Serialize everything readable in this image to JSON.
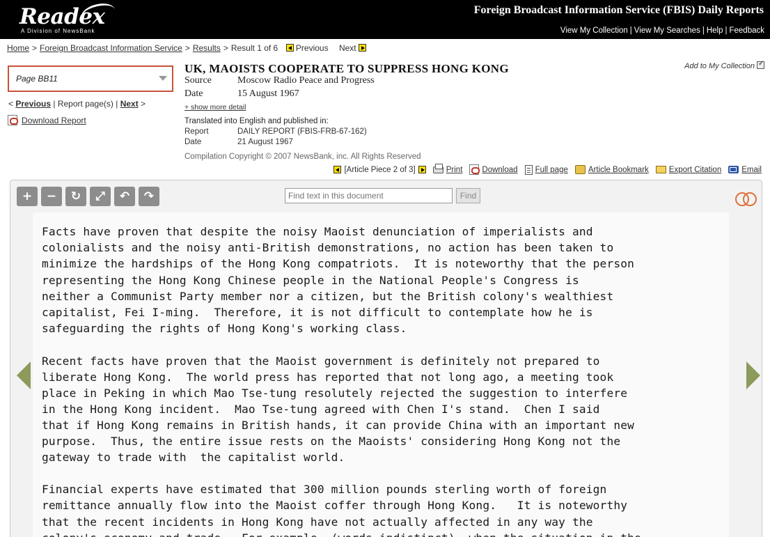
{
  "header": {
    "logo_text": "Readex",
    "logo_sub": "A Division of NewsBank",
    "site_title": "Foreign Broadcast Information Service (FBIS) Daily Reports",
    "links": [
      "View My Collection",
      "View My Searches",
      "Help",
      "Feedback"
    ]
  },
  "breadcrumb": {
    "home": "Home",
    "collection": "Foreign Broadcast Information Service",
    "results": "Results",
    "result_pos": "Result 1 of 6",
    "previous": "Previous",
    "next": "Next"
  },
  "left": {
    "page_select": "Page BB11",
    "prev": "Previous",
    "report_pages": "Report page(s)",
    "next": "Next",
    "download_report": "Download Report"
  },
  "article": {
    "title": "UK, MAOISTS COOPERATE TO SUPPRESS HONG KONG",
    "source_label": "Source",
    "source": "Moscow Radio Peace and Progress",
    "date_label": "Date",
    "date": "15 August 1967",
    "show_more": "+ show more detail",
    "translated_heading": "Translated into English and published in:",
    "report_label": "Report",
    "report": "DAILY REPORT (FBIS-FRB-67-162)",
    "report_date_label": "Date",
    "report_date": "21 August 1967",
    "copyright": "Compilation Copyright © 2007 NewsBank, inc. All Rights Reserved",
    "add_to_collection": "Add to My Collection"
  },
  "tools": {
    "article_piece": "[Article Piece 2 of 3]",
    "print": "Print",
    "download": "Download",
    "full_page": "Full page",
    "bookmark": "Article Bookmark",
    "export": "Export Citation",
    "email": "Email"
  },
  "viewer": {
    "find_placeholder": "Find text in this document",
    "find_button": "Find",
    "lines": [
      "Facts have proven that despite the noisy Maoist denunciation of imperialists and",
      "colonialists and the noisy anti-British demonstrations, no action has been taken to",
      "minimize the hardships of the Hong Kong compatriots.  It is noteworthy that the person",
      "representing the Hong Kong Chinese people in the National People's Congress is",
      "neither a Communist Party member nor a citizen, but the British colony's wealthiest",
      "capitalist, Fei I-ming.  Therefore, it is not difficult to contemplate how he is",
      "safeguarding the rights of Hong Kong's working class.",
      "Recent facts have proven that the Maoist government is definitely not prepared to",
      "liberate Hong Kong.  The world press has reported that not long ago, a meeting took",
      "place in Peking in which Mao Tse-tung resolutely rejected the suggestion to interfere",
      "in the Hong Kong incident.  Mao Tse-tung agreed with Chen I's stand.  Chen I said",
      "that if Hong Kong remains in British hands, it can provide China with an important new",
      "purpose.  Thus, the entire issue rests on the Maoists' considering Hong Kong not the",
      "gateway to trade with  the capitalist world.",
      "Financial experts have estimated that 300 million pounds sterling worth of foreign",
      "remittance annually flow into the Maoist coffer through Hong Kong.   It is noteworthy",
      "that the recent incidents in Hong Kong have not actually affected in any way the",
      "colony's economy and trade.  For example, (words indistinct), when the situation in the"
    ]
  }
}
